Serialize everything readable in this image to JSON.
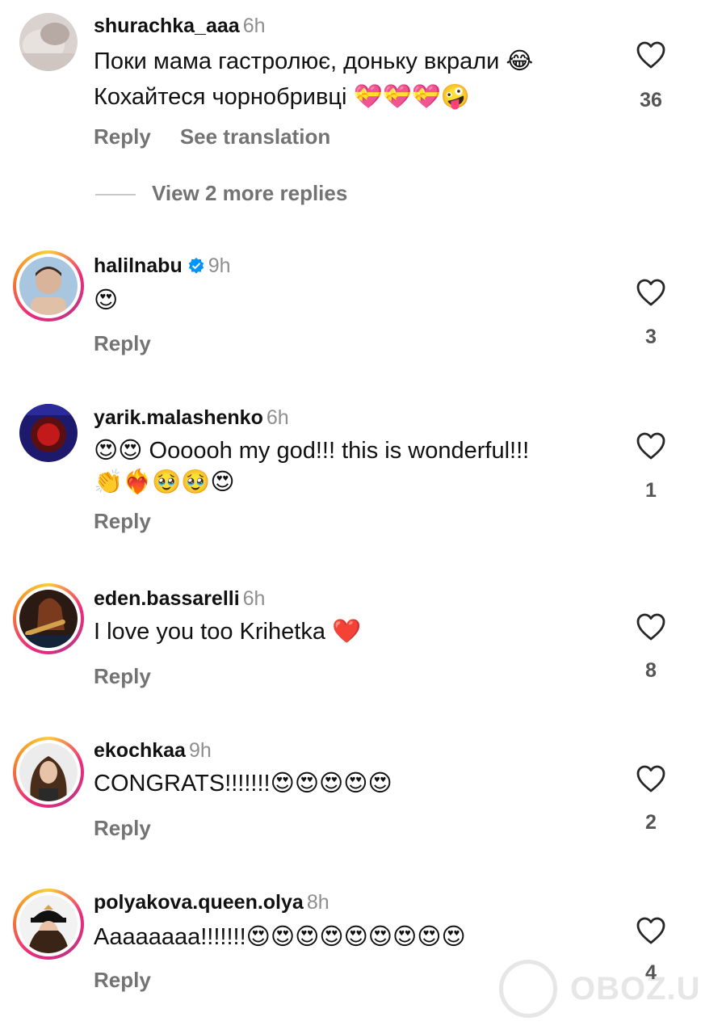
{
  "comments": [
    {
      "username": "shurachka_aaa",
      "time": "6h",
      "line1": "Поки мама гастролює, доньку вкрали 😂",
      "line2": "Кохайтеся чорнобривці 💝💝💝🤪",
      "reply": "Reply",
      "translate": "See translation",
      "likes": "36",
      "view_more": "View 2 more replies"
    },
    {
      "username": "halilnabu",
      "time": "9h",
      "verified": true,
      "line1": "😍",
      "reply": "Reply",
      "likes": "3"
    },
    {
      "username": "yarik.malashenko",
      "time": "6h",
      "line1": "😍😍 Oooooh my god!!! this is wonderful!!!",
      "line2": "👏❤️‍🔥🥹🥹😍",
      "reply": "Reply",
      "likes": "1"
    },
    {
      "username": "eden.bassarelli",
      "time": "6h",
      "line1": "I love you too Krihetka ❤️",
      "reply": "Reply",
      "likes": "8"
    },
    {
      "username": "ekochkaa",
      "time": "9h",
      "line1": "CONGRATS!!!!!!!😍😍😍😍😍",
      "reply": "Reply",
      "likes": "2"
    },
    {
      "username": "polyakova.queen.olya",
      "time": "8h",
      "line1": "Aaaaaaaa!!!!!!!😍😍😍😍😍😍😍😍😍",
      "reply": "Reply",
      "likes": "4"
    }
  ],
  "watermark": "OBOZ.UA",
  "colors": {
    "muted": "#8e8e8e",
    "verified": "#0095f6",
    "heart": "#ed4956"
  }
}
